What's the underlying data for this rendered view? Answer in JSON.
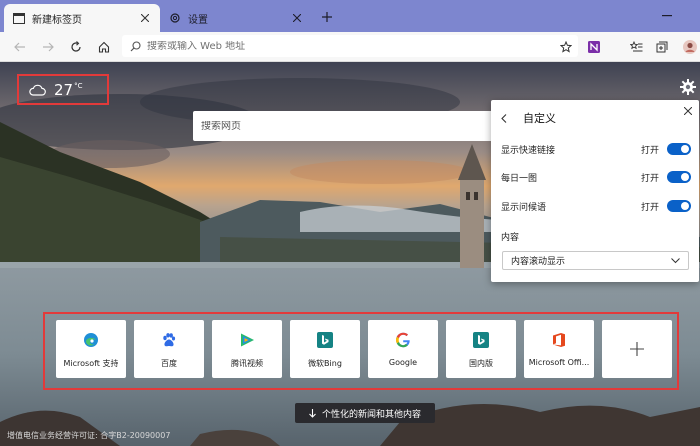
{
  "tabs": [
    {
      "title": "新建标签页",
      "icon": "new-tab-page-icon",
      "active": true
    },
    {
      "title": "设置",
      "icon": "settings-gear-icon",
      "active": false
    }
  ],
  "address_bar": {
    "placeholder": "搜索或输入 Web 地址",
    "value": ""
  },
  "weather": {
    "temperature": "27",
    "unit": "°C",
    "icon": "cloud-icon"
  },
  "search": {
    "placeholder": "搜索网页",
    "value": ""
  },
  "customize_panel": {
    "title": "自定义",
    "toggles": [
      {
        "label": "显示快速链接",
        "state_label": "打开",
        "on": true
      },
      {
        "label": "每日一图",
        "state_label": "打开",
        "on": true
      },
      {
        "label": "显示问候语",
        "state_label": "打开",
        "on": true
      }
    ],
    "content_label": "内容",
    "content_select": {
      "value": "内容滚动显示"
    }
  },
  "quick_links": [
    {
      "label": "Microsoft 支持",
      "icon": "edge-icon",
      "color": "#1f8fd6"
    },
    {
      "label": "百度",
      "icon": "baidu-paw-icon",
      "color": "#2f6be5"
    },
    {
      "label": "腾讯视频",
      "icon": "tencent-video-icon",
      "color": "#2ab96d"
    },
    {
      "label": "微软Bing",
      "icon": "bing-icon",
      "color": "#158384"
    },
    {
      "label": "Google",
      "icon": "google-icon",
      "color": "#4285f4"
    },
    {
      "label": "国内版",
      "icon": "bing-icon",
      "color": "#158384"
    },
    {
      "label": "Microsoft Offi...",
      "icon": "office-icon",
      "color": "#e5481e"
    }
  ],
  "add_link": {
    "icon": "plus-icon"
  },
  "news_button": {
    "label": "个性化的新闻和其他内容",
    "icon": "arrow-down-icon"
  },
  "license_text": "增值电信业务经营许可证: 合字B2-20090007",
  "colors": {
    "accent": "#0a61c8",
    "highlight_border": "#e23a3a",
    "titlebar": "#7d86cf"
  }
}
